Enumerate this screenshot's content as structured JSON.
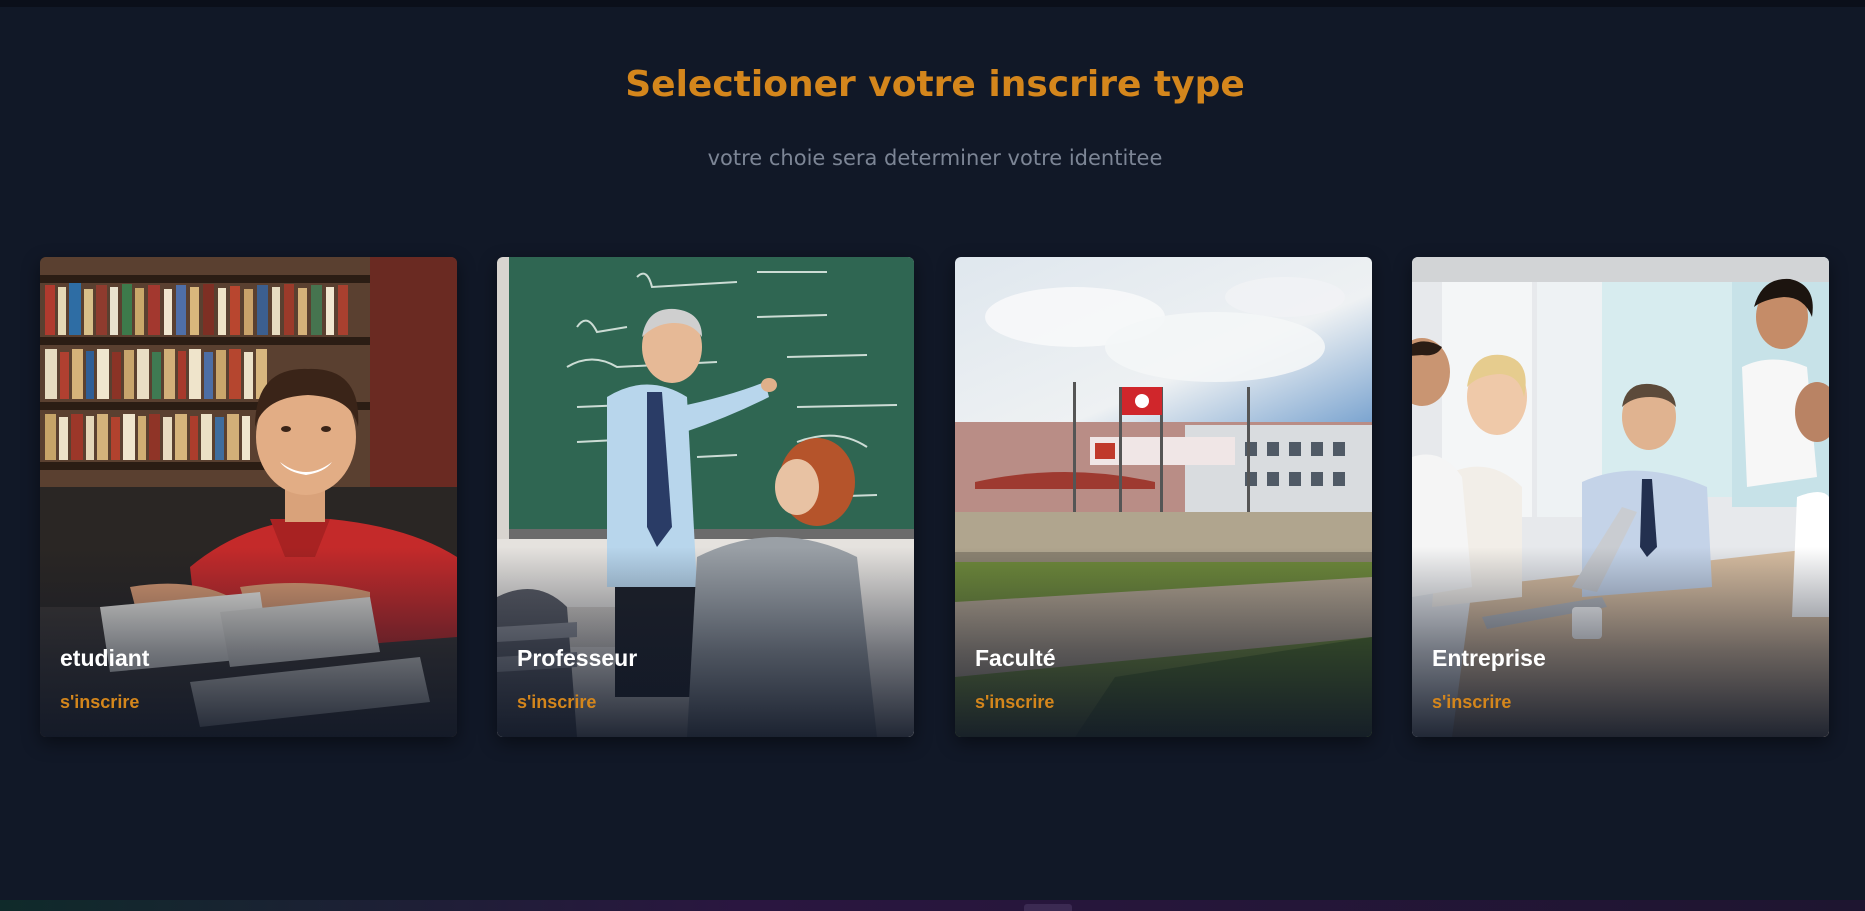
{
  "header": {
    "title": "Selectioner votre inscrire type",
    "subtitle": "votre choie sera determiner votre identitee"
  },
  "cards": [
    {
      "title": "etudiant",
      "cta": "s'inscrire",
      "image": "student-photo"
    },
    {
      "title": "Professeur",
      "cta": "s'inscrire",
      "image": "teacher-photo"
    },
    {
      "title": "Faculté",
      "cta": "s'inscrire",
      "image": "faculty-building-photo"
    },
    {
      "title": "Entreprise",
      "cta": "s'inscrire",
      "image": "business-meeting-photo"
    }
  ],
  "theme": {
    "background": "#111827",
    "accent": "#d4861c",
    "muted_text": "#7c8595",
    "card_title": "#ffffff"
  }
}
